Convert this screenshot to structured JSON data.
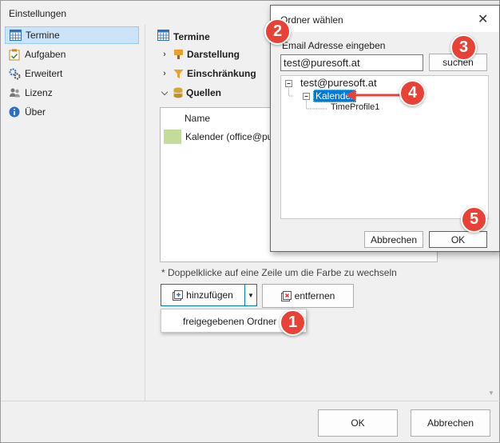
{
  "window": {
    "title": "Einstellungen"
  },
  "sidebar": {
    "items": [
      {
        "label": "Termine",
        "icon": "calendar-icon",
        "selected": true
      },
      {
        "label": "Aufgaben",
        "icon": "clipboard-check-icon",
        "selected": false
      },
      {
        "label": "Erweitert",
        "icon": "gears-icon",
        "selected": false
      },
      {
        "label": "Lizenz",
        "icon": "users-icon",
        "selected": false
      },
      {
        "label": "Über",
        "icon": "info-icon",
        "selected": false
      }
    ]
  },
  "main": {
    "title": "Termine",
    "sections": [
      {
        "label": "Darstellung",
        "icon": "paint-icon",
        "expanded": false
      },
      {
        "label": "Einschränkung",
        "icon": "filter-icon",
        "expanded": false
      },
      {
        "label": "Quellen",
        "icon": "database-icon",
        "expanded": true
      }
    ],
    "list": {
      "column_header": "Name",
      "rows": [
        {
          "name": "Kalender (office@pu",
          "color": "#c4dc9a"
        }
      ]
    },
    "hint": "* Doppelklicke auf eine Zeile um die Farbe zu wechseln",
    "add_button": "hinzufügen",
    "remove_button": "entfernen",
    "dropdown_item": "freigegebenen Ordner"
  },
  "footer": {
    "ok": "OK",
    "cancel": "Abbrechen"
  },
  "dialog": {
    "title": "Ordner wählen",
    "email_label": "Email Adresse eingeben",
    "email_value": "test@puresoft.at",
    "search_button": "suchen",
    "tree": {
      "root": "test@puresoft.at",
      "child": "Kalender",
      "grandchild": "TimeProfile1"
    },
    "cancel": "Abbrechen",
    "ok": "OK"
  },
  "badges": [
    "1",
    "2",
    "3",
    "4",
    "5"
  ],
  "colors": {
    "badge": "#e84236",
    "selection": "#cce4f7",
    "tree_selection": "#0078d7"
  }
}
